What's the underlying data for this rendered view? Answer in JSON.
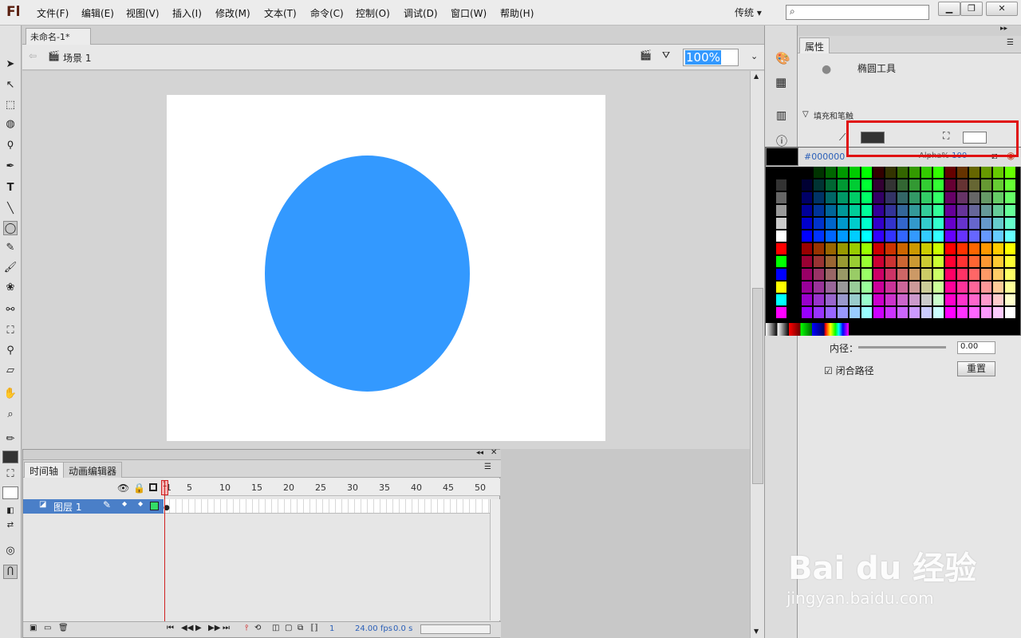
{
  "app": {
    "logo": "Fl",
    "workspace": "传统",
    "search_placeholder": ""
  },
  "menu": [
    "文件(F)",
    "编辑(E)",
    "视图(V)",
    "插入(I)",
    "修改(M)",
    "文本(T)",
    "命令(C)",
    "控制(O)",
    "调试(D)",
    "窗口(W)",
    "帮助(H)"
  ],
  "document": {
    "tab": "未命名-1*",
    "scene": "场景 1",
    "zoom": "100%"
  },
  "colors": {
    "shape_fill": "#3399ff",
    "accent_red": "#e01010",
    "stage": "#ffffff",
    "layer_selected": "#4a7fc8"
  },
  "timeline": {
    "tabs": [
      "时间轴",
      "动画编辑器"
    ],
    "frame_numbers": [
      "1",
      "5",
      "10",
      "15",
      "20",
      "25",
      "30",
      "35",
      "40",
      "45",
      "50"
    ],
    "layer_name": "图层 1",
    "current_frame": "1",
    "fps": "24.00",
    "fps_unit": "fps",
    "time": "0.0 s"
  },
  "properties": {
    "tab": "属性",
    "tool_name": "椭圆工具",
    "section": "填充和笔触",
    "hex": "#000000",
    "alpha_label": "Alpha%",
    "alpha_value": "100",
    "radius_label": "内径：",
    "radius_value": "0.00",
    "close_path": "闭合路径",
    "reset": "重置"
  },
  "watermark": {
    "brand": "Bai du 经验",
    "url": "jingyan.baidu.com"
  }
}
